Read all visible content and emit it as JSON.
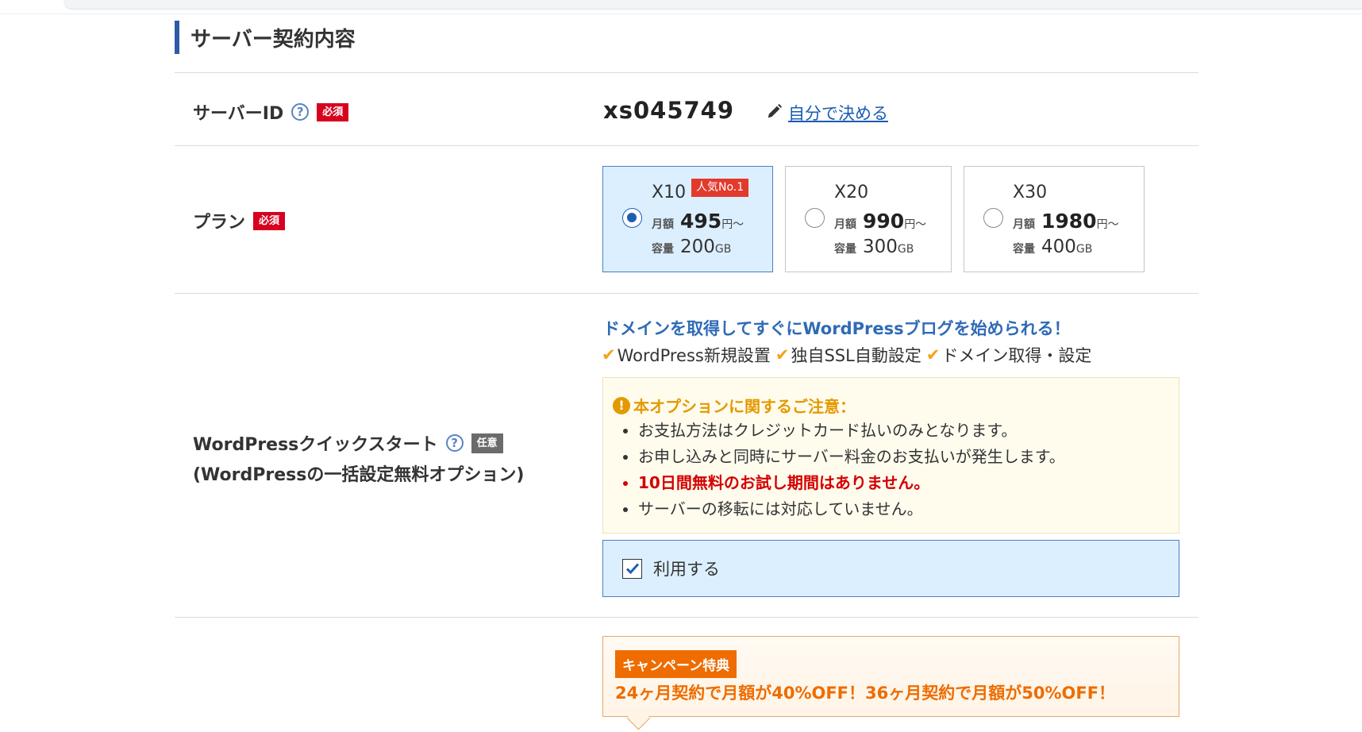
{
  "section": {
    "title": "サーバー契約内容"
  },
  "server_id": {
    "label": "サーバーID",
    "required_badge": "必須",
    "value": "xs045749",
    "edit_link": "自分で決める"
  },
  "plan": {
    "label": "プラン",
    "required_badge": "必須",
    "monthly_label": "月額",
    "capacity_label": "容量",
    "price_unit": "円～",
    "capacity_unit": "GB",
    "options": [
      {
        "name": "X10",
        "badge": "人気No.1",
        "price": "495",
        "capacity": "200",
        "selected": true
      },
      {
        "name": "X20",
        "price": "990",
        "capacity": "300",
        "selected": false
      },
      {
        "name": "X30",
        "price": "1980",
        "capacity": "400",
        "selected": false
      }
    ]
  },
  "quickstart": {
    "label_line1": "WordPressクイックスタート",
    "label_line2": "(WordPressの一括設定無料オプション)",
    "optional_badge": "任意",
    "headline": "ドメインを取得してすぐにWordPressブログを始められる！",
    "features": [
      "WordPress新規設置",
      "独自SSL自動設定",
      "ドメイン取得・設定"
    ],
    "notice_title": "本オプションに関するご注意：",
    "notice_items": [
      "お支払方法はクレジットカード払いのみとなります。",
      "お申し込みと同時にサーバー料金のお支払いが発生します。",
      "10日間無料のお試し期間はありません。",
      "サーバーの移転には対応していません。"
    ],
    "use_label": "利用する",
    "use_checked": true
  },
  "campaign": {
    "badge": "キャンペーン特典",
    "text": "24ヶ月契約で月額が40%OFF！36ヶ月契約で月額が50%OFF！"
  },
  "colors": {
    "accent_blue": "#2e5aa8",
    "required_red": "#d7001f",
    "selected_bg": "#dcefff",
    "warning_orange": "#e39a00",
    "campaign_orange": "#ee6c00"
  }
}
